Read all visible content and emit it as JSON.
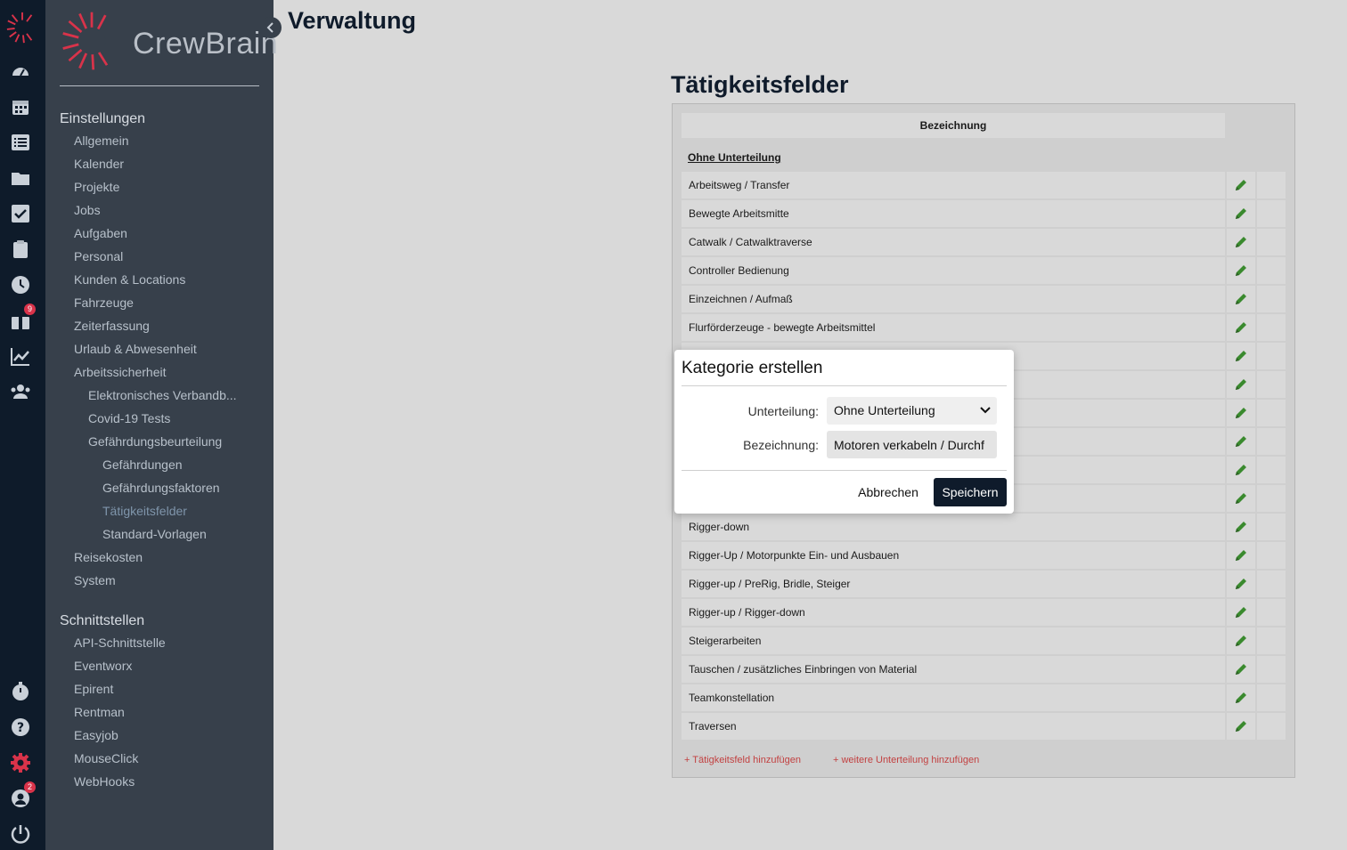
{
  "brand": {
    "name": "CrewBrain",
    "accent": "#d9334a"
  },
  "rail": {
    "icons": [
      {
        "name": "dashboard-icon"
      },
      {
        "name": "calendar-icon"
      },
      {
        "name": "list-icon"
      },
      {
        "name": "folder-icon"
      },
      {
        "name": "checkbox-icon"
      },
      {
        "name": "clipboard-icon"
      },
      {
        "name": "clock-icon"
      },
      {
        "name": "gift-icon",
        "badge": "9"
      },
      {
        "name": "chart-icon"
      },
      {
        "name": "users-icon"
      }
    ],
    "bottom_icons": [
      {
        "name": "stopwatch-icon"
      },
      {
        "name": "help-icon"
      },
      {
        "name": "settings-icon"
      },
      {
        "name": "user-icon",
        "badge": "2"
      },
      {
        "name": "power-icon"
      }
    ]
  },
  "sidebar": {
    "section1": "Einstellungen",
    "items": [
      "Allgemein",
      "Kalender",
      "Projekte",
      "Jobs",
      "Aufgaben",
      "Personal",
      "Kunden & Locations",
      "Fahrzeuge",
      "Zeiterfassung",
      "Urlaub & Abwesenheit",
      "Arbeitssicherheit"
    ],
    "sub": [
      "Elektronisches Verbandb...",
      "Covid-19 Tests",
      "Gefährdungsbeurteilung"
    ],
    "subsub": [
      "Gefährdungen",
      "Gefährdungsfaktoren",
      "Tätigkeitsfelder",
      "Standard-Vorlagen"
    ],
    "items2": [
      "Reisekosten",
      "System"
    ],
    "section2": "Schnittstellen",
    "items3": [
      "API-Schnittstelle",
      "Eventworx",
      "Epirent",
      "Rentman",
      "Easyjob",
      "MouseClick",
      "WebHooks"
    ]
  },
  "main": {
    "title": "Verwaltung",
    "section_title": "Tätigkeitsfelder",
    "table_header": "Bezeichnung",
    "group": "Ohne Unterteilung",
    "rows": [
      "Arbeitsweg / Transfer",
      "Bewegte Arbeitsmitte",
      "Catwalk / Catwalktraverse",
      "Controller Bedienung",
      "Einzeichnen / Aufmaß",
      "Flurförderzeuge - bewegte Arbeitsmittel",
      "",
      "",
      "",
      "",
      "",
      "",
      "Rigger-down",
      "Rigger-Up / Motorpunkte Ein- und Ausbauen",
      "Rigger-up / PreRig, Bridle, Steiger",
      "Rigger-up / Rigger-down",
      "Steigerarbeiten",
      "Tauschen / zusätzliches Einbringen von Material",
      "Teamkonstellation",
      "Traversen"
    ],
    "add_activity": "+ Tätigkeitsfeld hinzufügen",
    "add_division": "+ weitere Unterteilung hinzufügen"
  },
  "modal": {
    "title": "Kategorie erstellen",
    "division_label": "Unterteilung:",
    "division_value": "Ohne Unterteilung",
    "name_label": "Bezeichnung:",
    "name_value": "Motoren verkabeln / Durchf",
    "cancel": "Abbrechen",
    "save": "Speichern"
  }
}
